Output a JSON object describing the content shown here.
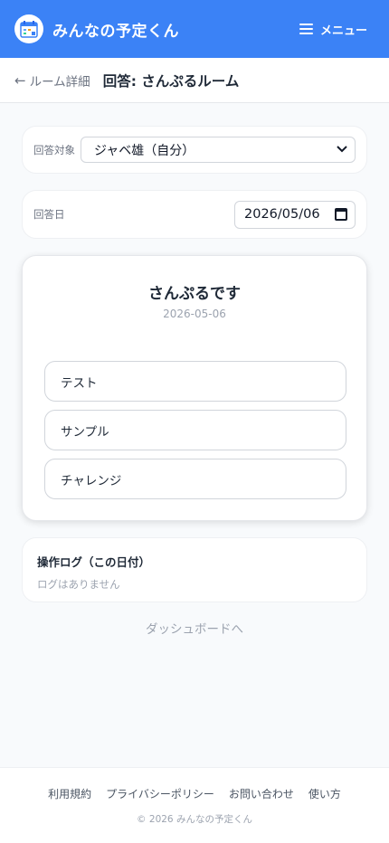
{
  "header": {
    "app_title": "みんなの予定くん",
    "menu_label": "メニュー",
    "logo_icon": "calendar-logo-icon",
    "menu_icon": "hamburger-icon",
    "bg_color": "#3b82f6"
  },
  "subheader": {
    "back_label": "ルーム詳細",
    "back_arrow": "←",
    "title": "回答: さんぷるルーム"
  },
  "target": {
    "label": "回答対象",
    "selected": "ジャベ雄（自分）"
  },
  "answer_date": {
    "label": "回答日",
    "value": "2026/05/06"
  },
  "main": {
    "title": "さんぷるです",
    "date": "2026-05-06",
    "options": [
      "テスト",
      "サンプル",
      "チャレンジ"
    ]
  },
  "log": {
    "title": "操作ログ（この日付）",
    "empty": "ログはありません"
  },
  "dashboard_link": "ダッシュボードへ",
  "footer": {
    "links": [
      "利用規約",
      "プライバシーポリシー",
      "お問い合わせ",
      "使い方"
    ],
    "copyright": "© 2026 みんなの予定くん"
  }
}
